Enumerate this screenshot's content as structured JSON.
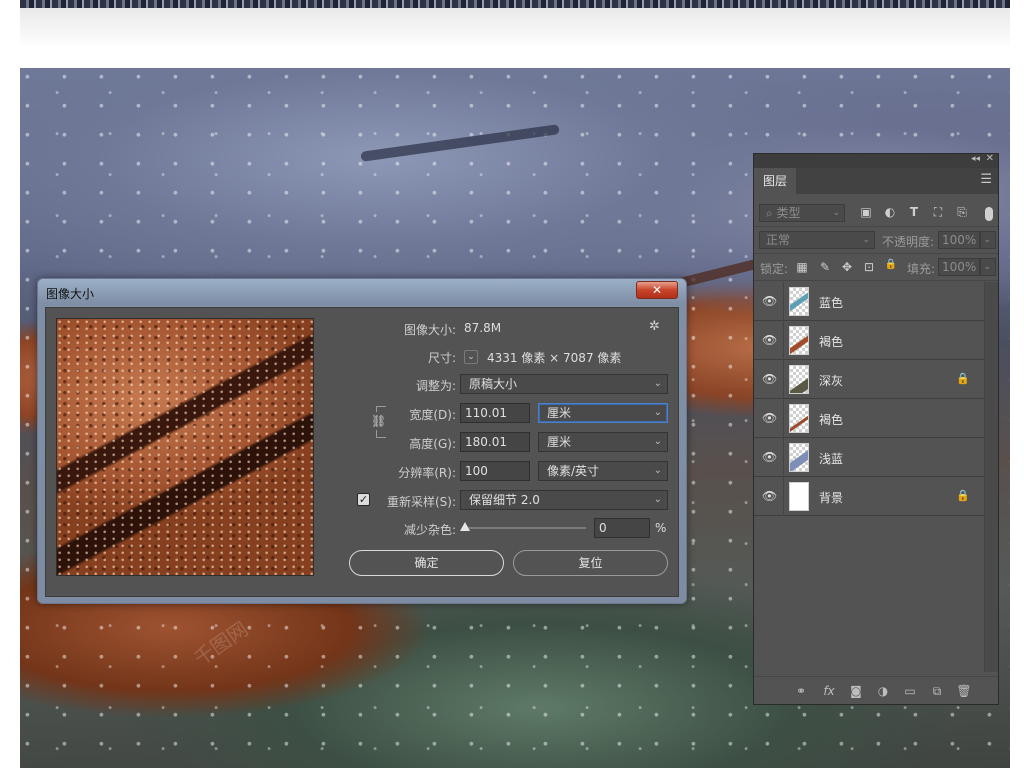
{
  "image_size_dialog": {
    "title": "图像大小",
    "close_label": "✕",
    "image_size_label": "图像大小:",
    "image_size_value": "87.8M",
    "dimensions_label": "尺寸:",
    "dimensions_value": "4331 像素 × 7087 像素",
    "fit_to_label": "调整为:",
    "fit_to_value": "原稿大小",
    "width_label": "宽度(D):",
    "width_value": "110.01",
    "width_unit": "厘米",
    "height_label": "高度(G):",
    "height_value": "180.01",
    "height_unit": "厘米",
    "resolution_label": "分辨率(R):",
    "resolution_value": "100",
    "resolution_unit": "像素/英寸",
    "resample_label": "重新采样(S):",
    "resample_checked": true,
    "resample_value": "保留细节 2.0",
    "reduce_noise_label": "减少杂色:",
    "reduce_noise_value": "0",
    "reduce_noise_unit": "%",
    "ok_label": "确定",
    "reset_label": "复位"
  },
  "layers_panel": {
    "tab_label": "图层",
    "filter_kind": "类型",
    "blend_mode": "正常",
    "opacity_label": "不透明度:",
    "opacity_value": "100%",
    "lock_label": "锁定:",
    "fill_label": "填充:",
    "fill_value": "100%",
    "layers": [
      {
        "name": "蓝色",
        "locked": false,
        "thumb_color": "#5e9fb8"
      },
      {
        "name": "褐色",
        "locked": false,
        "thumb_color": "#a24d2a"
      },
      {
        "name": "深灰",
        "locked": true,
        "thumb_color": "#5a5a44"
      },
      {
        "name": "褐色",
        "locked": false,
        "thumb_color": "#9a4a2a"
      },
      {
        "name": "浅蓝",
        "locked": false,
        "thumb_color": "#7d8fb6"
      },
      {
        "name": "背景",
        "locked": true,
        "thumb_color": "#ffffff"
      }
    ]
  },
  "icons": {
    "eye": "👁",
    "lock": "🔒",
    "gear": "✲",
    "chevron": "⌄",
    "link": "⛓",
    "menu": "☰"
  },
  "watermark_text": "千图网"
}
